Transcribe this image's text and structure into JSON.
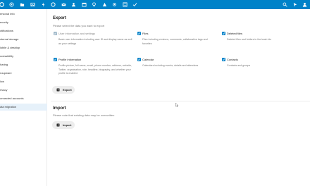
{
  "sidebar": {
    "items": [
      {
        "label": "ersonal info"
      },
      {
        "label": "ecurity"
      },
      {
        "label": "otifications"
      },
      {
        "label": "xternal storage"
      },
      {
        "label": "lobile & desktop"
      },
      {
        "label": "ccessibility"
      },
      {
        "label": "haring"
      },
      {
        "label": "roupware"
      },
      {
        "label": "low"
      },
      {
        "label": "rivacy"
      },
      {
        "label": "onnected accounts"
      },
      {
        "label": "ata migration"
      }
    ]
  },
  "export": {
    "title": "Export",
    "hint": "Please select the data you want to export",
    "options": [
      {
        "label": "User information and settings",
        "desc": "Basic user information including user ID and display name as well as your settings",
        "checked": true,
        "disabled": true
      },
      {
        "label": "Files",
        "desc": "Files including versions, comments, collaborative tags and favorites",
        "checked": true,
        "disabled": false
      },
      {
        "label": "Deleted files",
        "desc": "Deleted files and folders in the trash bin",
        "checked": true,
        "disabled": false
      },
      {
        "label": "Profile information",
        "desc": "Profile picture, full name, email, phone number, address, website, Twitter, organisation, role, headline, biography, and whether your profile is enabled",
        "checked": true,
        "disabled": false
      },
      {
        "label": "Calendar",
        "desc": "Calendars including events, details and attendees",
        "checked": true,
        "disabled": false
      },
      {
        "label": "Contacts",
        "desc": "Contacts and groups",
        "checked": true,
        "disabled": false
      }
    ],
    "button_label": "Export"
  },
  "import": {
    "title": "Import",
    "hint": "Please note that existing data may be overwritten",
    "button_label": "Import"
  },
  "topbar": {
    "app_icons": [
      "logo-icon",
      "dashboard-icon",
      "files-icon",
      "photos-icon",
      "activity-icon",
      "talk-icon",
      "mail-icon",
      "contacts-icon",
      "calendar-icon",
      "notes-icon",
      "maps-icon",
      "deck-icon",
      "settings-icon",
      "tasks-icon",
      "checkmarks-icon"
    ],
    "right_icons": [
      "search-icon",
      "notifications-icon",
      "user-avatar-icon"
    ],
    "color": "#0082c9"
  }
}
